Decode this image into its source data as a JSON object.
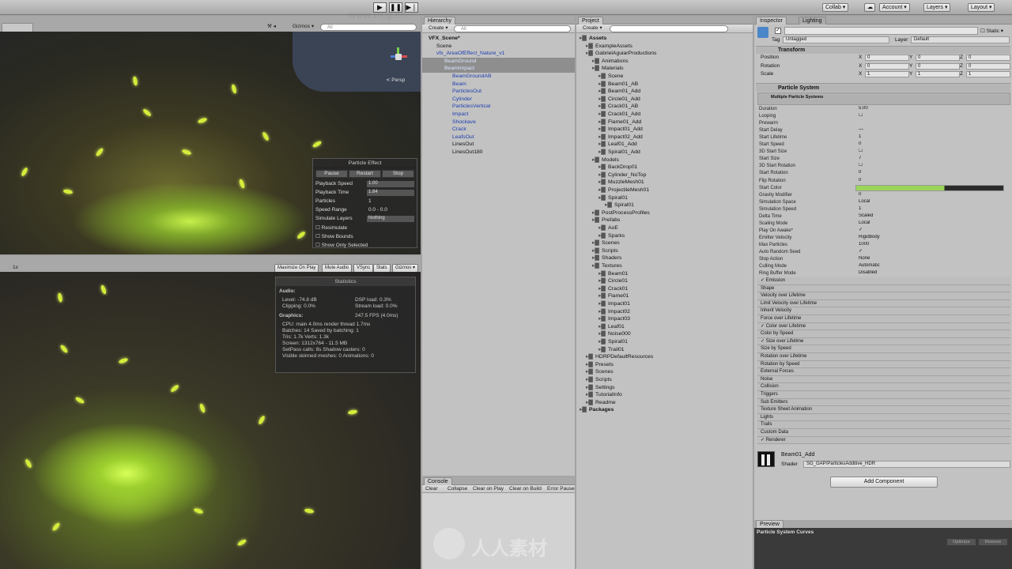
{
  "toolbar": {
    "collab": "Collab ▾",
    "account": "Account ▾",
    "layers": "Layers ▾",
    "layout": "Layout ▾"
  },
  "scene": {
    "gizmos": "Gizmos ▾",
    "search_placeholder": "All",
    "persp": "≺ Persp"
  },
  "particle_effect": {
    "title": "Particle Effect",
    "pause": "Pause",
    "restart": "Restart",
    "stop": "Stop",
    "fields": [
      {
        "k": "Playback Speed",
        "v": "1.00"
      },
      {
        "k": "Playback Time",
        "v": "1.84"
      },
      {
        "k": "Particles",
        "v": "1"
      },
      {
        "k": "Speed Range",
        "v": "0.0 - 0.0"
      },
      {
        "k": "Simulate Layers",
        "v": "Nothing"
      }
    ],
    "toggles": [
      "Resimulate",
      "Show Bounds",
      "Show Only Selected"
    ]
  },
  "game": {
    "scale": "1x",
    "buttons": [
      "Maximize On Play",
      "Mute Audio",
      "VSync",
      "Stats",
      "Gizmos ▾"
    ]
  },
  "stats": {
    "title": "Statistics",
    "audio": "Audio:",
    "level": "Level: -74.8 dB",
    "clipping": "Clipping: 0.0%",
    "dsp": "DSP load: 0.3%",
    "stream": "Stream load: 0.0%",
    "graphics": "Graphics:",
    "fps": "247.5 FPS (4.0ms)",
    "lines": [
      "CPU: main 4.0ms  render thread 1.7ms",
      "Batches: 14        Saved by batching: 1",
      "Tris: 1.7k          Verts: 1.3k",
      "Screen: 1312x764 - 11.5 MB",
      "SetPass calls: 8s     Shadow casters: 0",
      "Visible skinned meshes: 0  Animations: 0"
    ]
  },
  "hierarchy": {
    "tab": "Hierarchy",
    "create": "Create ▾",
    "search_placeholder": "All",
    "items": [
      {
        "t": "VFX_Scene*",
        "i": 0,
        "b": true,
        "s": false
      },
      {
        "t": "Scene",
        "i": 1,
        "b": false,
        "s": false
      },
      {
        "t": "vfx_AreaOfEffect_Nature_v1",
        "i": 1,
        "b": false,
        "s": false,
        "blue": true
      },
      {
        "t": "BeamGround",
        "i": 2,
        "b": false,
        "s": true,
        "blue": true
      },
      {
        "t": "BeamImpact",
        "i": 2,
        "b": false,
        "s": true,
        "blue": true
      },
      {
        "t": "BeamGroundAB",
        "i": 3,
        "blue": true
      },
      {
        "t": "Beam",
        "i": 3,
        "blue": true
      },
      {
        "t": "ParticlesOut",
        "i": 3,
        "blue": true
      },
      {
        "t": "Cylinder",
        "i": 3,
        "blue": true
      },
      {
        "t": "ParticlesVertical",
        "i": 3,
        "blue": true
      },
      {
        "t": "Impact",
        "i": 3,
        "blue": true
      },
      {
        "t": "Shockave",
        "i": 3,
        "blue": true
      },
      {
        "t": "Crack",
        "i": 3,
        "blue": true
      },
      {
        "t": "LeafsOut",
        "i": 3,
        "blue": true
      },
      {
        "t": "LinesOut",
        "i": 3
      },
      {
        "t": "LinesOut180",
        "i": 3
      }
    ]
  },
  "console": {
    "tab": "Console",
    "buttons": [
      "Clear",
      "Collapse",
      "Clear on Play",
      "Clear on Build",
      "Error Pause"
    ]
  },
  "project": {
    "tab": "Project",
    "create": "Create ▾",
    "items": [
      {
        "t": "Assets",
        "i": 0,
        "b": true
      },
      {
        "t": "ExampleAssets",
        "i": 1
      },
      {
        "t": "GabrielAguiarProductions",
        "i": 1
      },
      {
        "t": "Animations",
        "i": 2
      },
      {
        "t": "Materials",
        "i": 2
      },
      {
        "t": "Scene",
        "i": 3
      },
      {
        "t": "Beam01_AB",
        "i": 3
      },
      {
        "t": "Beam01_Add",
        "i": 3
      },
      {
        "t": "Circle01_Add",
        "i": 3
      },
      {
        "t": "Crack01_AB",
        "i": 3
      },
      {
        "t": "Crack01_Add",
        "i": 3
      },
      {
        "t": "Flame01_Add",
        "i": 3
      },
      {
        "t": "Impact01_Add",
        "i": 3
      },
      {
        "t": "Impact02_Add",
        "i": 3
      },
      {
        "t": "Leaf01_Add",
        "i": 3
      },
      {
        "t": "Spiral01_Add",
        "i": 3
      },
      {
        "t": "Models",
        "i": 2
      },
      {
        "t": "BackDrop01",
        "i": 3
      },
      {
        "t": "Cylinder_NoTop",
        "i": 3
      },
      {
        "t": "MuzzleMesh01",
        "i": 3
      },
      {
        "t": "ProjectileMesh01",
        "i": 3
      },
      {
        "t": "Spiral01",
        "i": 3
      },
      {
        "t": "Spiral01",
        "i": 4
      },
      {
        "t": "PostProcessProfiles",
        "i": 2
      },
      {
        "t": "Prefabs",
        "i": 2
      },
      {
        "t": "AoE",
        "i": 3
      },
      {
        "t": "Sparks",
        "i": 3
      },
      {
        "t": "Scenes",
        "i": 2
      },
      {
        "t": "Scripts",
        "i": 2
      },
      {
        "t": "Shaders",
        "i": 2
      },
      {
        "t": "Textures",
        "i": 2
      },
      {
        "t": "Beam01",
        "i": 3
      },
      {
        "t": "Circle01",
        "i": 3
      },
      {
        "t": "Crack01",
        "i": 3
      },
      {
        "t": "Flame01",
        "i": 3
      },
      {
        "t": "Impact01",
        "i": 3
      },
      {
        "t": "Impact02",
        "i": 3
      },
      {
        "t": "Impact03",
        "i": 3
      },
      {
        "t": "Leaf01",
        "i": 3
      },
      {
        "t": "Noise000",
        "i": 3
      },
      {
        "t": "Spiral01",
        "i": 3
      },
      {
        "t": "Trail01",
        "i": 3
      },
      {
        "t": "HDRPDefaultResources",
        "i": 1
      },
      {
        "t": "Presets",
        "i": 1
      },
      {
        "t": "Scenes",
        "i": 1
      },
      {
        "t": "Scripts",
        "i": 1
      },
      {
        "t": "Settings",
        "i": 1
      },
      {
        "t": "TutorialInfo",
        "i": 1
      },
      {
        "t": "Readme",
        "i": 1
      },
      {
        "t": "Packages",
        "i": 0,
        "b": true
      }
    ]
  },
  "inspector": {
    "tab": "Inspector",
    "lighting": "Lighting",
    "static": "Static ▾",
    "tag_label": "Tag",
    "tag": "Untagged",
    "layer_label": "Layer",
    "layer": "Default",
    "transform": "Transform",
    "transform_rows": [
      {
        "k": "Position",
        "x": "0",
        "y": "0",
        "z": "0"
      },
      {
        "k": "Rotation",
        "x": "0",
        "y": "0",
        "z": "0"
      },
      {
        "k": "Scale",
        "x": "1",
        "y": "1",
        "z": "1"
      }
    ],
    "ps_title": "Particle System",
    "ps_sub": "Multiple Particle Systems",
    "ps_rows": [
      {
        "k": "Duration",
        "v": "5.00"
      },
      {
        "k": "Looping",
        "v": "☐"
      },
      {
        "k": "Prewarm",
        "v": ""
      },
      {
        "k": "Start Delay",
        "v": "—"
      },
      {
        "k": "Start Lifetime",
        "v": "1"
      },
      {
        "k": "Start Speed",
        "v": "0"
      },
      {
        "k": "3D Start Size",
        "v": "☐"
      },
      {
        "k": "Start Size",
        "v": "7"
      },
      {
        "k": "3D Start Rotation",
        "v": "☐"
      },
      {
        "k": "Start Rotation",
        "v": "0"
      },
      {
        "k": "Flip Rotation",
        "v": "0"
      },
      {
        "k": "Start Color",
        "v": ""
      },
      {
        "k": "Gravity Modifier",
        "v": "0"
      },
      {
        "k": "Simulation Space",
        "v": "Local"
      },
      {
        "k": "Simulation Speed",
        "v": "1"
      },
      {
        "k": "Delta Time",
        "v": "Scaled"
      },
      {
        "k": "Scaling Mode",
        "v": "Local"
      },
      {
        "k": "Play On Awake*",
        "v": "✓"
      },
      {
        "k": "Emitter Velocity",
        "v": "Rigidbody"
      },
      {
        "k": "Max Particles",
        "v": "1000"
      },
      {
        "k": "Auto Random Seed",
        "v": "✓"
      },
      {
        "k": "Stop Action",
        "v": "None"
      },
      {
        "k": "Culling Mode",
        "v": "Automatic"
      },
      {
        "k": "Ring Buffer Mode",
        "v": "Disabled"
      }
    ],
    "modules": [
      "✓ Emission",
      "Shape",
      "Velocity over Lifetime",
      "Limit Velocity over Lifetime",
      "Inherit Velocity",
      "Force over Lifetime",
      "✓ Color over Lifetime",
      "Color by Speed",
      "✓ Size over Lifetime",
      "Size by Speed",
      "Rotation over Lifetime",
      "Rotation by Speed",
      "External Forces",
      "Noise",
      "Collision",
      "Triggers",
      "Sub Emitters",
      "Texture Sheet Animation",
      "Lights",
      "Trails",
      "Custom Data",
      "✓ Renderer"
    ],
    "material": "Beam01_Add",
    "shader_label": "Shader",
    "shader": "SG_GAP/ParticlesAdditive_HDR",
    "add_component": "Add Component",
    "preview": "Preview",
    "curves": "Particle System Curves",
    "optimize": "Optimize",
    "remove": "Remove"
  },
  "watermark": {
    "text": "人人素材",
    "site": "www.rrcg.cn"
  }
}
